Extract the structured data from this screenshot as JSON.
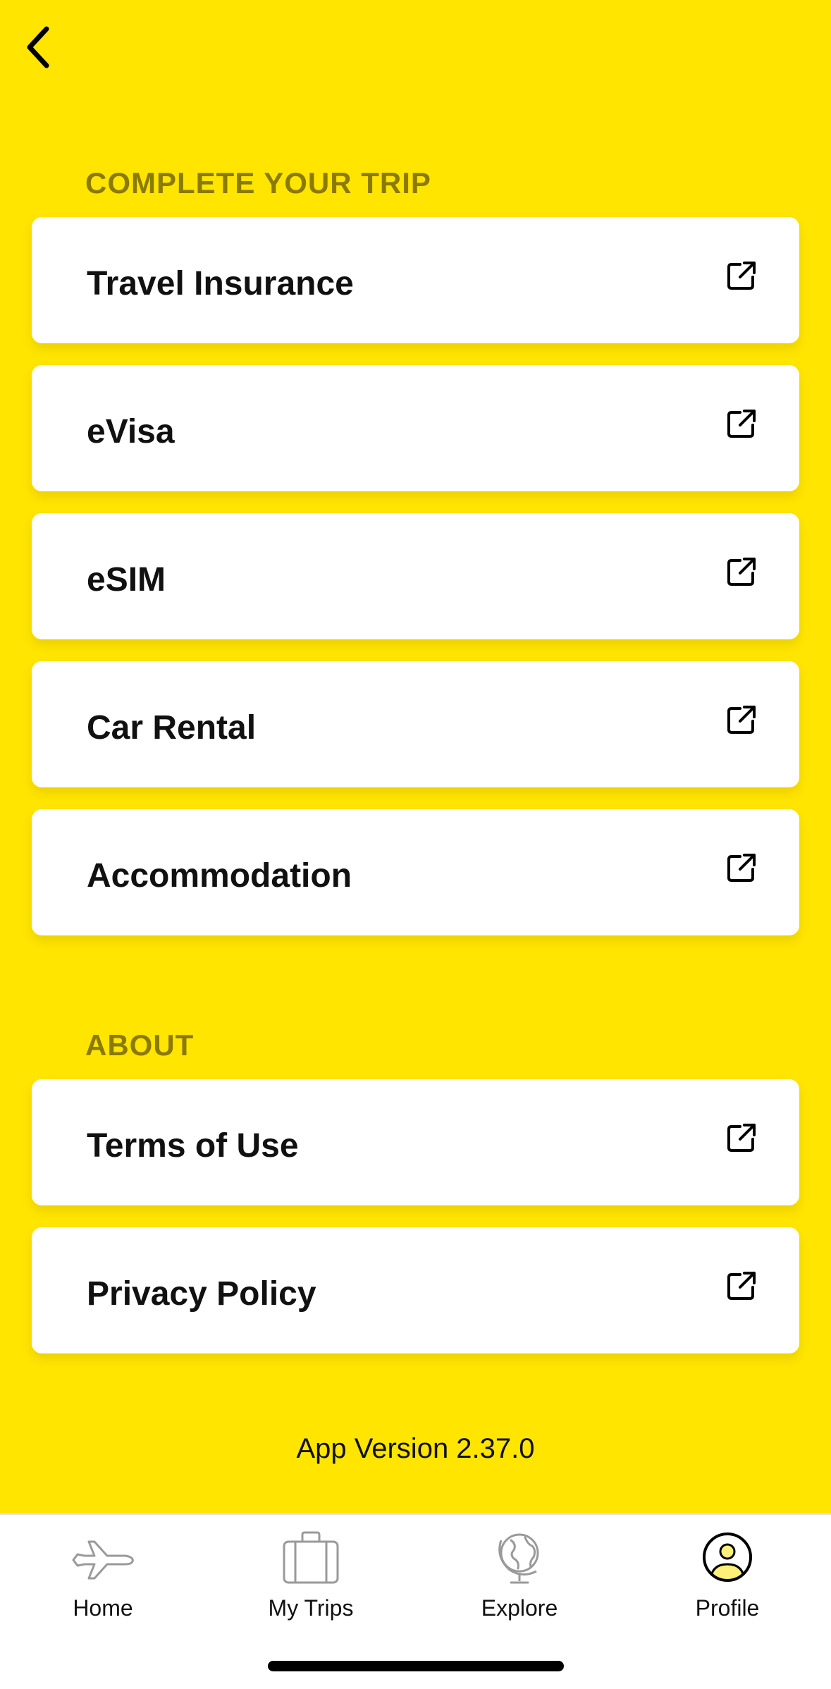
{
  "header": {
    "back_icon": "chevron-left-icon"
  },
  "sections": [
    {
      "title": "COMPLETE YOUR TRIP",
      "items": [
        {
          "label": "Travel Insurance",
          "icon": "external-link-icon"
        },
        {
          "label": "eVisa",
          "icon": "external-link-icon"
        },
        {
          "label": "eSIM",
          "icon": "external-link-icon"
        },
        {
          "label": "Car Rental",
          "icon": "external-link-icon"
        },
        {
          "label": "Accommodation",
          "icon": "external-link-icon"
        }
      ]
    },
    {
      "title": "ABOUT",
      "items": [
        {
          "label": "Terms of Use",
          "icon": "external-link-icon"
        },
        {
          "label": "Privacy Policy",
          "icon": "external-link-icon"
        }
      ]
    }
  ],
  "footer": {
    "version": "App Version 2.37.0"
  },
  "tabbar": {
    "selected": "Profile",
    "tabs": [
      {
        "label": "Home",
        "icon": "airplane-icon"
      },
      {
        "label": "My Trips",
        "icon": "suitcase-icon"
      },
      {
        "label": "Explore",
        "icon": "globe-icon"
      },
      {
        "label": "Profile",
        "icon": "profile-icon"
      }
    ]
  },
  "colors": {
    "background": "#FFE500",
    "section_title": "#8A7A00",
    "card": "#FFFFFF",
    "text": "#111111",
    "inactive_icon": "#9A9A9A",
    "profile_accent": "#FFF07A"
  }
}
